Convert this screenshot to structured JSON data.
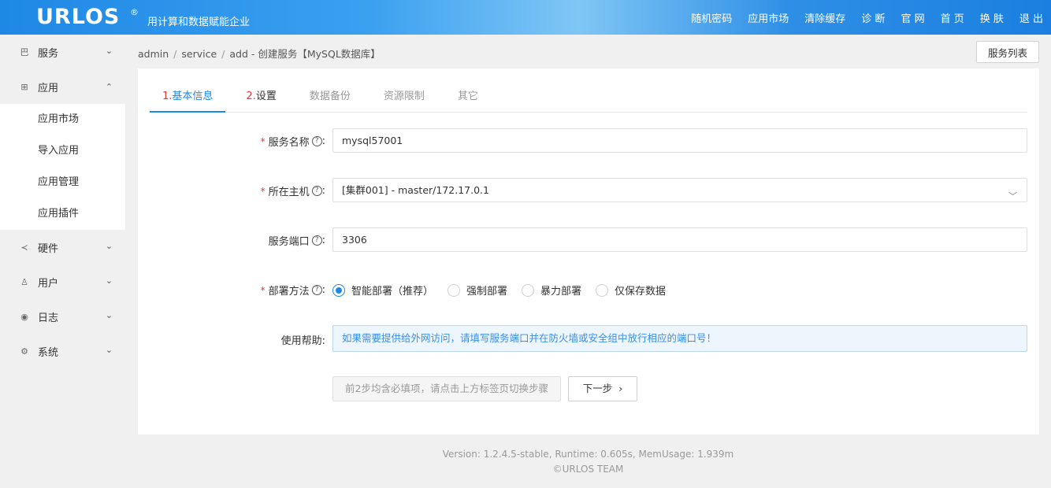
{
  "header": {
    "logo": "URLOS",
    "logo_mark": "®",
    "slogan": "用计算和数据赋能企业",
    "nav": [
      "随机密码",
      "应用市场",
      "清除缓存",
      "诊 断",
      "官 网",
      "首 页",
      "换 肤",
      "退 出"
    ]
  },
  "sidebar": {
    "items": [
      {
        "label": "服务",
        "icon": "grid-icon",
        "glyph": "巴",
        "chevron": "⌄"
      },
      {
        "label": "应用",
        "icon": "apps-icon",
        "glyph": "⊞",
        "chevron": "⌃"
      },
      {
        "label": "硬件",
        "icon": "share-icon",
        "glyph": "≺",
        "chevron": "⌄"
      },
      {
        "label": "用户",
        "icon": "user-icon",
        "glyph": "♙",
        "chevron": "⌄"
      },
      {
        "label": "日志",
        "icon": "eye-icon",
        "glyph": "◉",
        "chevron": "⌄"
      },
      {
        "label": "系统",
        "icon": "gear-icon",
        "glyph": "⚙",
        "chevron": "⌄"
      }
    ],
    "app_sub": [
      "应用市场",
      "导入应用",
      "应用管理",
      "应用插件"
    ]
  },
  "breadcrumb": {
    "parts": [
      "admin",
      "service",
      "add"
    ],
    "separator": "/",
    "tail": " - 创建服务【MySQL数据库】"
  },
  "list_button": "服务列表",
  "tabs": [
    {
      "num": "1.",
      "label": "基本信息",
      "state": "active"
    },
    {
      "num": "2.",
      "label": "设置",
      "state": "done"
    },
    {
      "num": "",
      "label": "数据备份",
      "state": "disabled"
    },
    {
      "num": "",
      "label": "资源限制",
      "state": "disabled"
    },
    {
      "num": "",
      "label": "其它",
      "state": "disabled"
    }
  ],
  "form": {
    "service_name": {
      "label": "服务名称",
      "value": "mysql57001",
      "required": "*"
    },
    "host": {
      "label": "所在主机",
      "value": "[集群001] - master/172.17.0.1",
      "required": "*"
    },
    "port": {
      "label": "服务端口",
      "value": "3306"
    },
    "deploy": {
      "label": "部署方法",
      "required": "*",
      "options": [
        "智能部署（推荐）",
        "强制部署",
        "暴力部署",
        "仅保存数据"
      ],
      "selected": 0
    },
    "help": {
      "label": "使用帮助:",
      "text": "如果需要提供给外网访问，请填写服务端口并在防火墙或安全组中放行相应的端口号！"
    },
    "hint_button": "前2步均含必填项，请点击上方标签页切换步骤",
    "next_button": "下一步",
    "next_arrow": "›",
    "help_glyph": "?",
    "colon": ":"
  },
  "footer": {
    "line1": "Version: 1.2.4.5-stable,   Runtime: 0.605s,   MemUsage: 1.939m",
    "line2": "©URLOS TEAM"
  },
  "colors": {
    "accent": "#1e88e5",
    "required": "#e53935",
    "help_text": "#3a8ee6"
  }
}
